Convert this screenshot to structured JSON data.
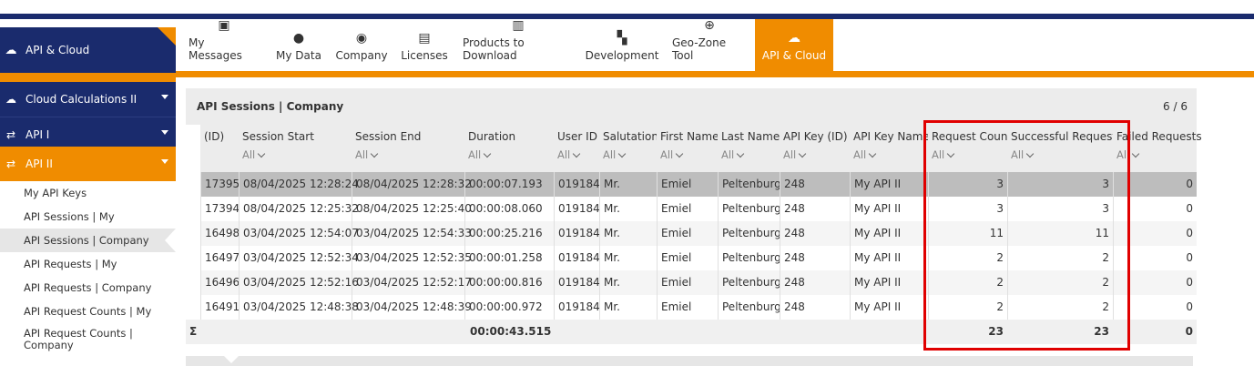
{
  "sidebar": {
    "header": {
      "label": "API & Cloud",
      "icon": "cloud-icon"
    },
    "items": [
      {
        "label": "Cloud Calculations II",
        "icon": "cloud-upload-icon",
        "color": "#1a2b6d"
      },
      {
        "label": "API I",
        "icon": "api-icon",
        "color": "#1a2b6d"
      },
      {
        "label": "API II",
        "icon": "api-icon",
        "color": "#f08c00"
      }
    ],
    "subitems": [
      {
        "label": "My API Keys"
      },
      {
        "label": "API Sessions | My"
      },
      {
        "label": "API Sessions | Company",
        "active": true
      },
      {
        "label": "API Requests | My"
      },
      {
        "label": "API Requests | Company"
      },
      {
        "label": "API Request Counts | My"
      },
      {
        "label": "API Request Counts | Company"
      }
    ]
  },
  "tabs": [
    {
      "label": "My Messages",
      "icon": "id-card-icon"
    },
    {
      "label": "My Data",
      "icon": "user-icon"
    },
    {
      "label": "Company",
      "icon": "map-pin-icon"
    },
    {
      "label": "Licenses",
      "icon": "license-icon"
    },
    {
      "label": "Products to Download",
      "icon": "books-icon"
    },
    {
      "label": "Development",
      "icon": "modules-icon"
    },
    {
      "label": "Geo-Zone Tool",
      "icon": "globe-icon"
    },
    {
      "label": "API & Cloud",
      "icon": "cloud-icon",
      "active": true
    }
  ],
  "panel": {
    "title": "API Sessions | Company",
    "count": "6 / 6"
  },
  "filter_label": "All",
  "columns": [
    "(ID)",
    "Session Start",
    "Session End",
    "Duration",
    "User ID",
    "Salutation",
    "First Name",
    "Last Name",
    "API Key (ID)",
    "API Key Name",
    "Request Count",
    "Successful Requests",
    "Failed Requests"
  ],
  "rows": [
    [
      "17395",
      "08/04/2025 12:28:24",
      "08/04/2025 12:28:32",
      "00:00:07.193",
      "019184",
      "Mr.",
      "Emiel",
      "Peltenburg",
      "248",
      "My API II",
      "3",
      "3",
      "0"
    ],
    [
      "17394",
      "08/04/2025 12:25:32",
      "08/04/2025 12:25:40",
      "00:00:08.060",
      "019184",
      "Mr.",
      "Emiel",
      "Peltenburg",
      "248",
      "My API II",
      "3",
      "3",
      "0"
    ],
    [
      "16498",
      "03/04/2025 12:54:07",
      "03/04/2025 12:54:33",
      "00:00:25.216",
      "019184",
      "Mr.",
      "Emiel",
      "Peltenburg",
      "248",
      "My API II",
      "11",
      "11",
      "0"
    ],
    [
      "16497",
      "03/04/2025 12:52:34",
      "03/04/2025 12:52:35",
      "00:00:01.258",
      "019184",
      "Mr.",
      "Emiel",
      "Peltenburg",
      "248",
      "My API II",
      "2",
      "2",
      "0"
    ],
    [
      "16496",
      "03/04/2025 12:52:16",
      "03/04/2025 12:52:17",
      "00:00:00.816",
      "019184",
      "Mr.",
      "Emiel",
      "Peltenburg",
      "248",
      "My API II",
      "2",
      "2",
      "0"
    ],
    [
      "16491",
      "03/04/2025 12:48:38",
      "03/04/2025 12:48:39",
      "00:00:00.972",
      "019184",
      "Mr.",
      "Emiel",
      "Peltenburg",
      "248",
      "My API II",
      "2",
      "2",
      "0"
    ]
  ],
  "totals": {
    "symbol": "Σ",
    "duration": "00:00:43.515",
    "request_count": "23",
    "successful": "23",
    "failed": "0"
  },
  "colors": {
    "navy": "#1a2b6d",
    "orange": "#f08c00",
    "highlight": "#e00000",
    "selected_row": "#bdbdbd"
  }
}
